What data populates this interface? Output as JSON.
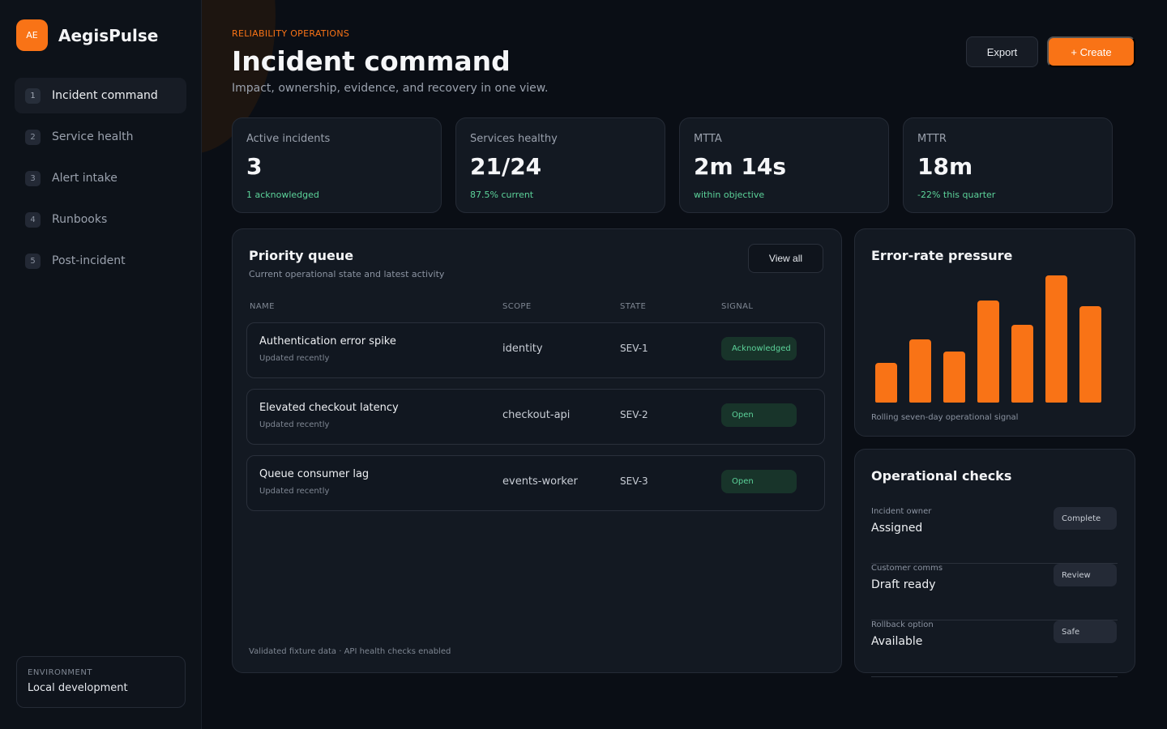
{
  "brand": {
    "logo": "AE",
    "name": "AegisPulse"
  },
  "nav": [
    {
      "num": "1",
      "label": "Incident command",
      "active": true
    },
    {
      "num": "2",
      "label": "Service health"
    },
    {
      "num": "3",
      "label": "Alert intake"
    },
    {
      "num": "4",
      "label": "Runbooks"
    },
    {
      "num": "5",
      "label": "Post-incident"
    }
  ],
  "environment": {
    "label": "ENVIRONMENT",
    "value": "Local development"
  },
  "header": {
    "eyebrow": "RELIABILITY OPERATIONS",
    "title": "Incident command",
    "subtitle": "Impact, ownership, evidence, and recovery in one view.",
    "export_label": "Export",
    "create_label": "+ Create"
  },
  "kpis": [
    {
      "label": "Active incidents",
      "value": "3",
      "note": "1 acknowledged"
    },
    {
      "label": "Services healthy",
      "value": "21/24",
      "note": "87.5% current"
    },
    {
      "label": "MTTA",
      "value": "2m 14s",
      "note": "within objective"
    },
    {
      "label": "MTTR",
      "value": "18m",
      "note": "-22% this quarter"
    }
  ],
  "queue": {
    "title": "Priority queue",
    "subtitle": "Current operational state and latest activity",
    "view_all_label": "View all",
    "columns": [
      "NAME",
      "SCOPE",
      "STATE",
      "SIGNAL"
    ],
    "rows": [
      {
        "name": "Authentication error spike",
        "meta": "Updated recently",
        "scope": "identity",
        "state": "SEV-1",
        "signal": "Acknowledged"
      },
      {
        "name": "Elevated checkout latency",
        "meta": "Updated recently",
        "scope": "checkout-api",
        "state": "SEV-2",
        "signal": "Open"
      },
      {
        "name": "Queue consumer lag",
        "meta": "Updated recently",
        "scope": "events-worker",
        "state": "SEV-3",
        "signal": "Open"
      }
    ],
    "footnote": "Validated fixture data · API health checks enabled"
  },
  "error_chart": {
    "title": "Error-rate pressure",
    "caption": "Rolling seven-day operational signal"
  },
  "chart_data": {
    "type": "bar",
    "title": "Error-rate pressure",
    "values": [
      31,
      50,
      40,
      80,
      61,
      100,
      76
    ],
    "ylim": [
      0,
      100
    ],
    "color": "#f97316"
  },
  "checks": {
    "title": "Operational checks",
    "items": [
      {
        "label": "Incident owner",
        "value": "Assigned",
        "badge": "Complete"
      },
      {
        "label": "Customer comms",
        "value": "Draft ready",
        "badge": "Review"
      },
      {
        "label": "Rollback option",
        "value": "Available",
        "badge": "Safe"
      }
    ]
  },
  "colors": {
    "accent": "#f97316",
    "success": "#5cd39a",
    "background": "#0a0e15",
    "card": "#131922"
  }
}
